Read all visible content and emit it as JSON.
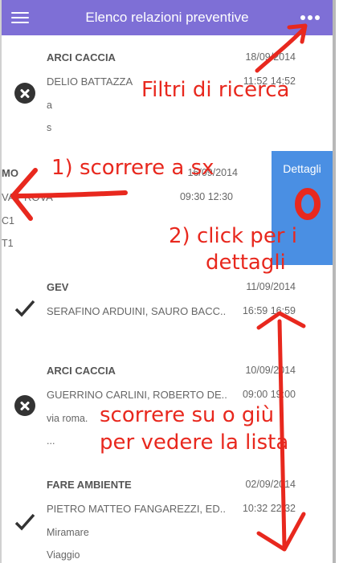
{
  "header": {
    "title": "Elenco relazioni preventive",
    "menu_icon": "hamburger-menu-icon",
    "more_icon": "more-dots-icon"
  },
  "items": [
    {
      "org": "ARCI CACCIA",
      "date": "18/09/2014",
      "people": "DELIO BATTAZZA",
      "time": "11:52 14:52",
      "line3": "a",
      "line4": "s",
      "status": "cancelled"
    },
    {
      "org": "MO",
      "date": "16/09/2014",
      "people": "VA PROVA",
      "time": "09:30 12:30",
      "line3": "C1",
      "line4": "T1",
      "status": "swiped",
      "action": "Dettagli"
    },
    {
      "org": "GEV",
      "date": "11/09/2014",
      "people": "SERAFINO ARDUINI, SAURO BACC..",
      "time": "16:59 16:59",
      "line3": "",
      "line4": "",
      "status": "done"
    },
    {
      "org": "ARCI CACCIA",
      "date": "10/09/2014",
      "people": "GUERRINO CARLINI, ROBERTO DE..",
      "time": "09:00 19:00",
      "line3": "via roma.",
      "line4": "...",
      "status": "cancelled"
    },
    {
      "org": "FARE AMBIENTE",
      "date": "02/09/2014",
      "people": "PIETRO MATTEO FANGAREZZI, ED..",
      "time": "10:32 22:32",
      "line3": "Miramare",
      "line4": "Viaggio",
      "status": "done"
    }
  ],
  "annotations": {
    "filters": "Filtri di ricerca",
    "swipe": "1) scorrere a sx",
    "click_line1": "2) click per i",
    "click_line2": "dettagli",
    "scroll_line1": "scorrere su o giù",
    "scroll_line2": "per vedere la lista"
  },
  "colors": {
    "header": "#7e6fd6",
    "details_button": "#4a8fe3",
    "annotation": "#e8281e"
  }
}
